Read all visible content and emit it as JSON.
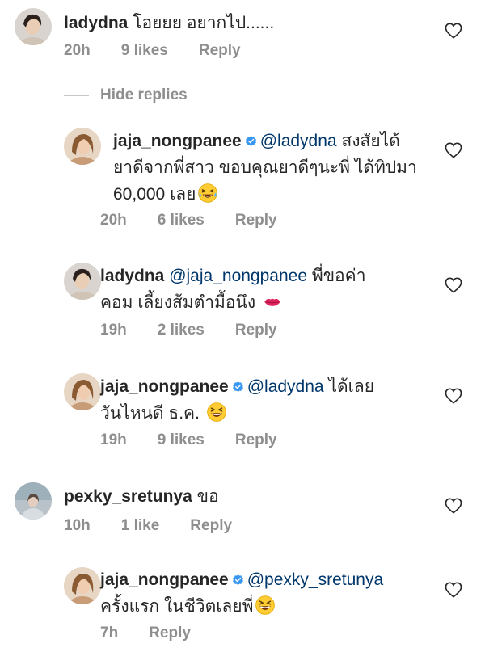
{
  "comments": [
    {
      "username": "ladydna",
      "text": "โอยยย อยากไป......",
      "time": "20h",
      "likes": "9 likes",
      "reply": "Reply"
    },
    {
      "username": "jaja_nongpanee",
      "mention": "@ladydna",
      "text_line1": "สงสัยได้",
      "text_line2": "ยาดีจากพี่สาว ขอบคุณยาดีๆนะพี่ ได้ทิปมา",
      "text_line3": "60,000 เลย",
      "time": "20h",
      "likes": "6 likes",
      "reply": "Reply"
    },
    {
      "username": "ladydna",
      "mention": "@jaja_nongpanee",
      "text_line1": "พี่ขอค่า",
      "text_line2": "คอม เลี้ยงส้มตำมื้อนึง",
      "time": "19h",
      "likes": "2 likes",
      "reply": "Reply"
    },
    {
      "username": "jaja_nongpanee",
      "mention": "@ladydna",
      "text_line1": "ได้เลย",
      "text_line2": "วันไหนดี ธ.ค.",
      "time": "19h",
      "likes": "9 likes",
      "reply": "Reply"
    },
    {
      "username": "pexky_sretunya",
      "text": "ขอ",
      "time": "10h",
      "likes": "1 like",
      "reply": "Reply"
    },
    {
      "username": "jaja_nongpanee",
      "mention": "@pexky_sretunya",
      "text_line2": "ครั้งแรก ในชีวิตเลยพี่",
      "time": "7h",
      "reply": "Reply"
    }
  ],
  "hide_replies": "Hide replies",
  "icons": {
    "heart": "heart-outline-icon",
    "verified": "verified-badge-icon",
    "emoji_laugh_tears": "face-with-tears-of-joy-emoji",
    "emoji_kiss": "kiss-mark-emoji",
    "emoji_grin": "grinning-squinting-face-emoji"
  },
  "colors": {
    "text": "#262626",
    "meta": "#8e8e8e",
    "mention": "#00376b",
    "verified": "#3897f0"
  }
}
